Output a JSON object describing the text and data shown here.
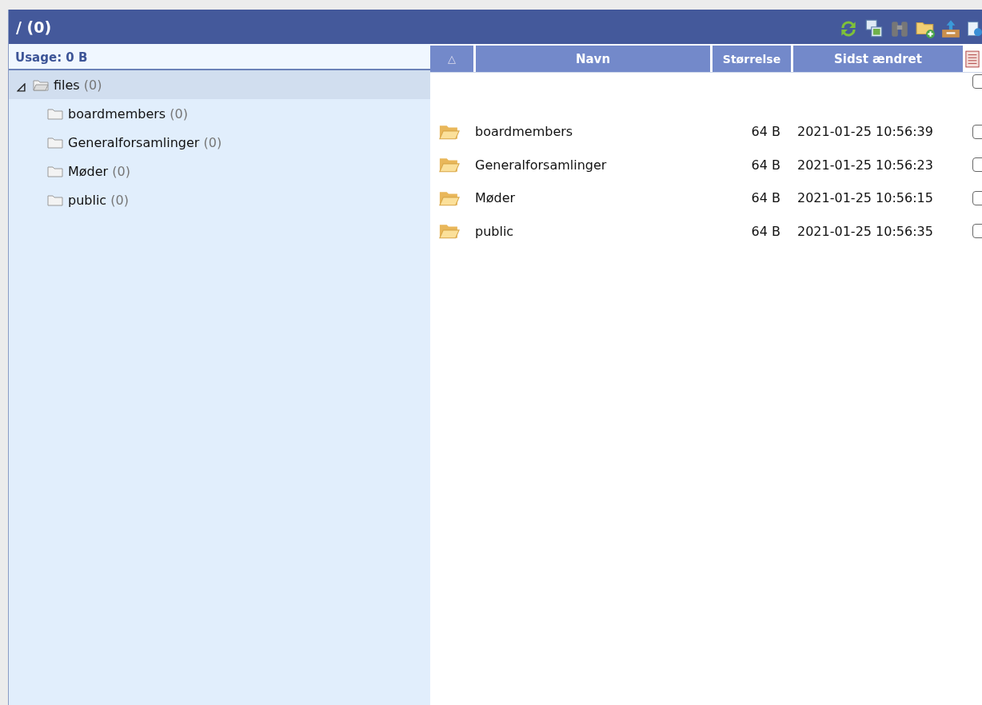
{
  "header": {
    "title": "/ (0)",
    "tools": [
      {
        "kind": "refresh"
      },
      {
        "kind": "thumbnails"
      },
      {
        "kind": "search"
      },
      {
        "kind": "new-folder"
      },
      {
        "kind": "upload"
      },
      {
        "kind": "web"
      }
    ]
  },
  "sidebar": {
    "usage": "Usage: 0 B",
    "tree": [
      {
        "name": "files",
        "count": "(0)",
        "expanded": true,
        "selected": true,
        "children": [
          {
            "name": "boardmembers",
            "count": "(0)",
            "selected": false
          },
          {
            "name": "Generalforsamlinger",
            "count": "(0)",
            "selected": false
          },
          {
            "name": "Møder",
            "count": "(0)",
            "selected": false
          },
          {
            "name": "public",
            "count": "(0)",
            "selected": false
          }
        ]
      }
    ]
  },
  "table": {
    "sort_indicator": "△",
    "columns": [
      "Navn",
      "Størrelse",
      "Sidst ændret"
    ],
    "select_all": {
      "checked": false
    },
    "rows": [
      {
        "name": "boardmembers",
        "size": "64 B",
        "modified": "2021-01-25 10:56:39",
        "checked": false
      },
      {
        "name": "Generalforsamlinger",
        "size": "64 B",
        "modified": "2021-01-25 10:56:23",
        "checked": false
      },
      {
        "name": "Møder",
        "size": "64 B",
        "modified": "2021-01-25 10:56:15",
        "checked": false
      },
      {
        "name": "public",
        "size": "64 B",
        "modified": "2021-01-25 10:56:35",
        "checked": false
      }
    ]
  }
}
